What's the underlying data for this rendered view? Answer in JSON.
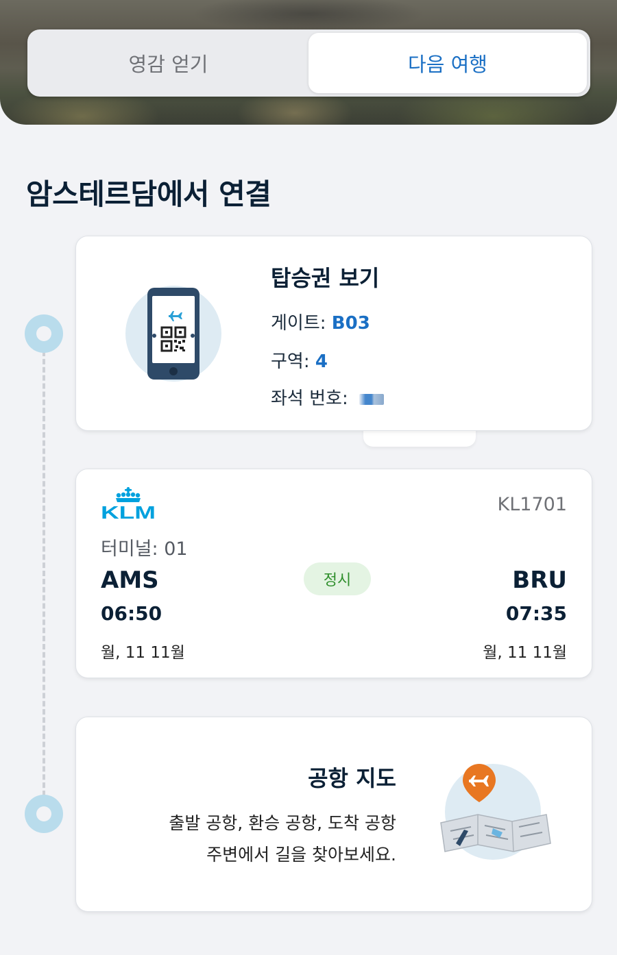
{
  "tabs": {
    "inspire_label": "영감 얻기",
    "next_trip_label": "다음 여행",
    "active": "next_trip"
  },
  "section": {
    "title": "암스테르담에서 연결"
  },
  "boarding_pass": {
    "title": "탑승권 보기",
    "gate_label": "게이트: ",
    "gate_value": "B03",
    "zone_label": "구역: ",
    "zone_value": "4",
    "seat_label": "좌석 번호: "
  },
  "flight": {
    "airline": "KLM",
    "flight_number": "KL1701",
    "terminal": "터미널: 01",
    "status": "정시",
    "origin": {
      "code": "AMS",
      "time": "06:50",
      "date": "월, 11 11월"
    },
    "destination": {
      "code": "BRU",
      "time": "07:35",
      "date": "월, 11 11월"
    }
  },
  "airport_map": {
    "title": "공항 지도",
    "description_line1": "출발 공항, 환승 공항, 도착 공항",
    "description_line2": "주변에서 길을 찾아보세요."
  },
  "colors": {
    "accent": "#1a6fc4",
    "klm_blue": "#00a1de",
    "status_green": "#2f8f2c",
    "timeline": "#b9dcec",
    "map_pin": "#e87722"
  },
  "icons": {
    "boarding_pass": "phone-qr-icon",
    "airport_map": "map-pin-plane-icon",
    "airline": "klm-crown-logo"
  }
}
